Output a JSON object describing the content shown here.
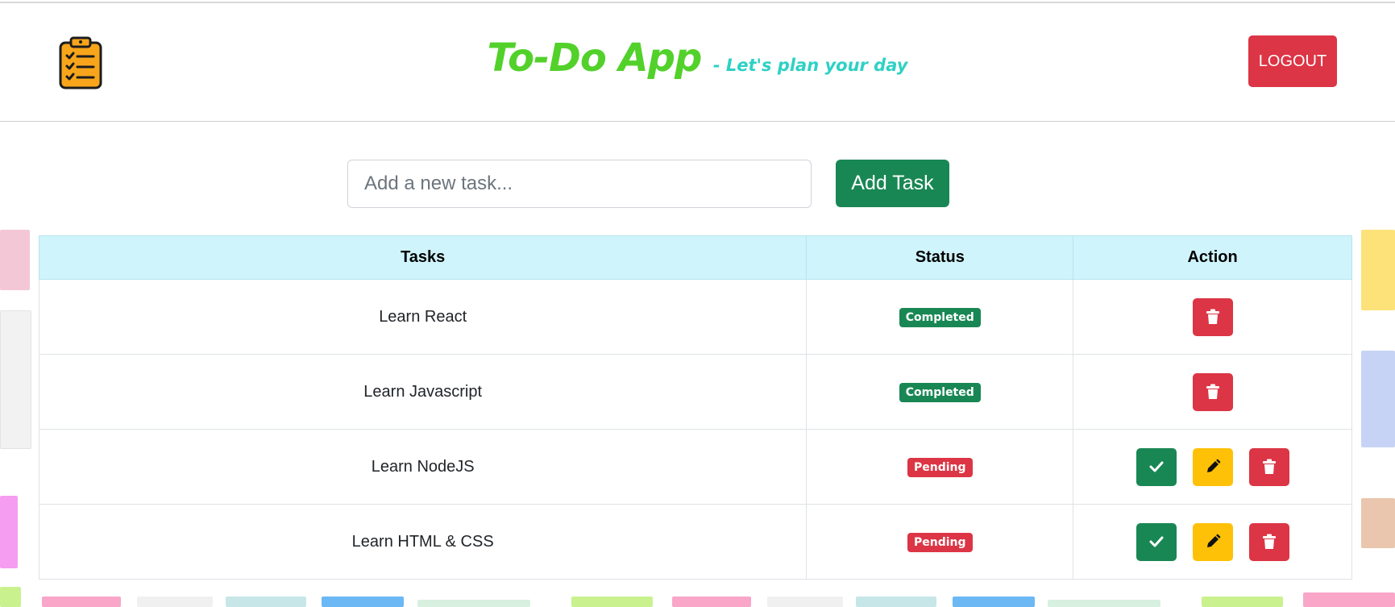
{
  "header": {
    "logo_icon": "clipboard-checklist-icon",
    "title": "To-Do App",
    "subtitle": "- Let's plan your day",
    "logout_label": "LOGOUT"
  },
  "form": {
    "placeholder": "Add a new task...",
    "value": "",
    "add_label": "Add Task"
  },
  "table": {
    "headers": [
      "Tasks",
      "Status",
      "Action"
    ],
    "rows": [
      {
        "task": "Learn React",
        "status": "Completed",
        "actions": [
          "delete"
        ]
      },
      {
        "task": "Learn Javascript",
        "status": "Completed",
        "actions": [
          "delete"
        ]
      },
      {
        "task": "Learn NodeJS",
        "status": "Pending",
        "actions": [
          "complete",
          "edit",
          "delete"
        ]
      },
      {
        "task": "Learn HTML & CSS",
        "status": "Pending",
        "actions": [
          "complete",
          "edit",
          "delete"
        ]
      }
    ]
  },
  "icons": {
    "complete": "check-icon",
    "edit": "pencil-icon",
    "delete": "trash-icon"
  },
  "colors": {
    "title": "#52d12b",
    "subtitle": "#2ed1c4",
    "success": "#198754",
    "danger": "#dc3545",
    "warning": "#ffc107",
    "table_header": "#cff4fc"
  }
}
